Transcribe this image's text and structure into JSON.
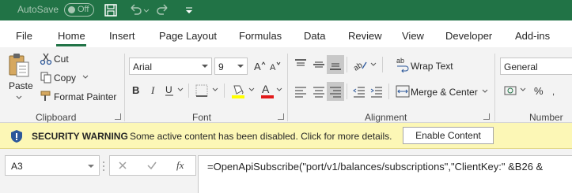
{
  "titlebar": {
    "autosave_label": "AutoSave",
    "autosave_state": "Off",
    "icons": [
      "save-icon",
      "undo-icon",
      "redo-icon",
      "customize-qat-icon"
    ]
  },
  "tabs": [
    "File",
    "Home",
    "Insert",
    "Page Layout",
    "Formulas",
    "Data",
    "Review",
    "View",
    "Developer",
    "Add-ins"
  ],
  "active_tab": "Home",
  "ribbon": {
    "clipboard": {
      "paste_label": "Paste",
      "cut_label": "Cut",
      "copy_label": "Copy",
      "format_painter_label": "Format Painter",
      "group_label": "Clipboard"
    },
    "font": {
      "font_name": "Arial",
      "font_size": "9",
      "group_label": "Font"
    },
    "alignment": {
      "wrap_text_label": "Wrap Text",
      "merge_center_label": "Merge & Center",
      "group_label": "Alignment"
    },
    "number": {
      "format": "General",
      "group_label": "Number"
    }
  },
  "security": {
    "title": "SECURITY WARNING",
    "message": "Some active content has been disabled. Click for more details.",
    "button_label": "Enable Content"
  },
  "formula_bar": {
    "name_box": "A3",
    "fx_label": "fx",
    "formula": "=OpenApiSubscribe(\"port/v1/balances/subscriptions\",\"ClientKey:\" &B26 &"
  },
  "colors": {
    "accent": "#217346",
    "warning_bg": "#fcf7b6",
    "font_color_red": "#e21b1b",
    "fill_yellow": "#ffff00"
  }
}
